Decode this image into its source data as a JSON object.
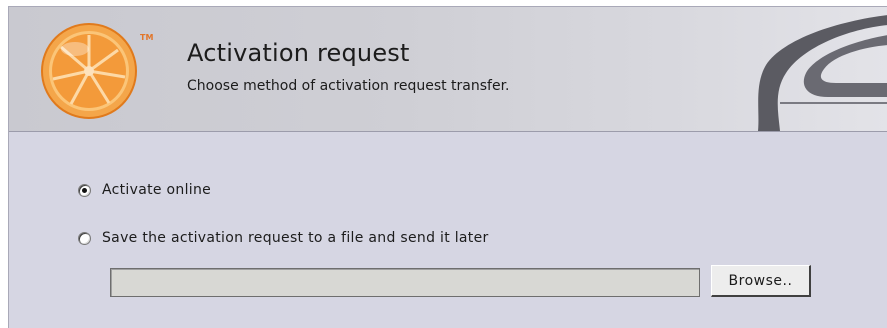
{
  "header": {
    "title": "Activation request",
    "subtitle": "Choose method of activation request transfer.",
    "trademark": "TM",
    "logo_icon": "orange-slice-logo"
  },
  "options": [
    {
      "label": "Activate online",
      "checked": true
    },
    {
      "label": "Save the activation request to a file and send it later",
      "checked": false
    }
  ],
  "file_path": {
    "value": "",
    "placeholder": ""
  },
  "browse_button": {
    "label": "Browse.."
  },
  "colors": {
    "panel_background": "#d6d6e3",
    "header_background": "#cfcfd5",
    "logo_orange": "#f39a3a"
  }
}
